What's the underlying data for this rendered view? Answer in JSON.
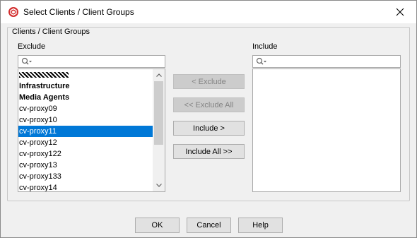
{
  "window": {
    "title": "Select Clients / Client Groups",
    "icon": "commvault-app-icon",
    "close_icon": "close-icon"
  },
  "group": {
    "legend": "Clients / Client Groups"
  },
  "exclude": {
    "label": "Exclude",
    "search_value": "",
    "items": [
      {
        "label": "",
        "masked": true
      },
      {
        "label": "Infrastructure",
        "bold": true
      },
      {
        "label": "Media Agents",
        "bold": true
      },
      {
        "label": "cv-proxy09"
      },
      {
        "label": "cv-proxy10"
      },
      {
        "label": "cv-proxy11",
        "selected": true
      },
      {
        "label": "cv-proxy12"
      },
      {
        "label": "cv-proxy122"
      },
      {
        "label": "cv-proxy13"
      },
      {
        "label": "cv-proxy133"
      },
      {
        "label": "cv-proxy14"
      }
    ]
  },
  "include": {
    "label": "Include",
    "search_value": "",
    "items": []
  },
  "transfer_buttons": {
    "exclude": "< Exclude",
    "exclude_all": "<< Exclude All",
    "include": "Include >",
    "include_all": "Include All >>"
  },
  "footer": {
    "ok": "OK",
    "cancel": "Cancel",
    "help": "Help"
  },
  "colors": {
    "selection": "#0078d7",
    "dialog_bg": "#f0f0f0",
    "app_icon": "#d32f2f"
  }
}
